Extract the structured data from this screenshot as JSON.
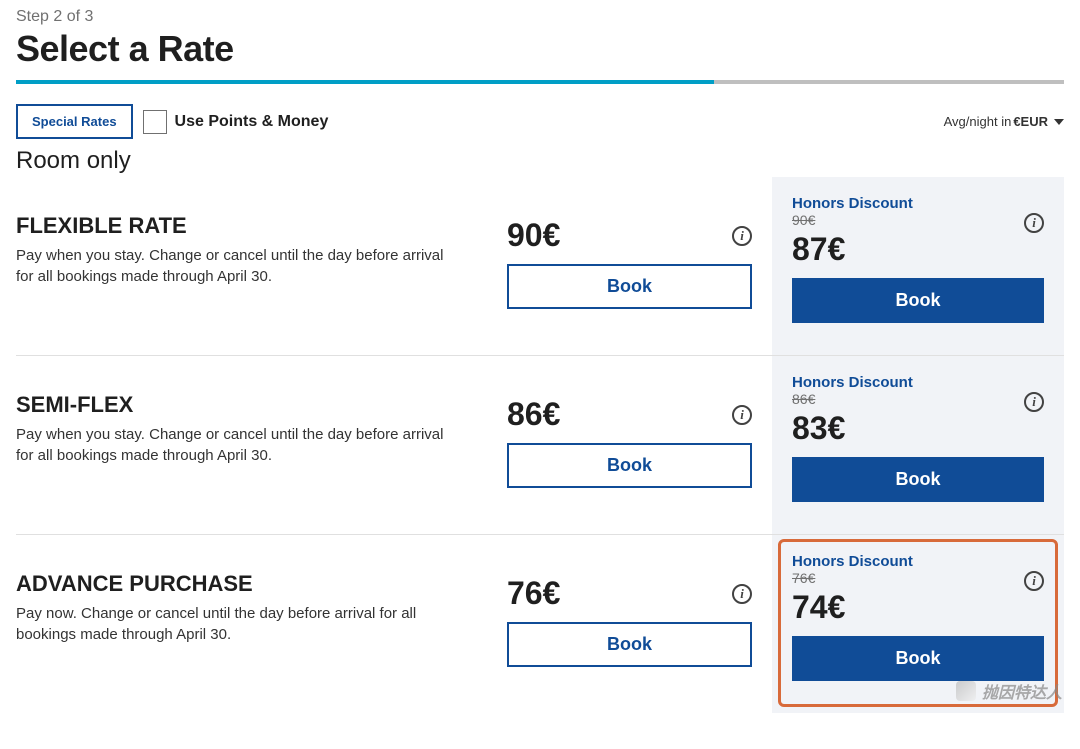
{
  "header": {
    "step": "Step 2 of 3",
    "title": "Select a Rate"
  },
  "options": {
    "special_rates": "Special Rates",
    "use_points": "Use Points & Money",
    "avg_prefix": "Avg/night in ",
    "currency": "€EUR"
  },
  "section_label": "Room only",
  "book_label": "Book",
  "honors_label": "Honors Discount",
  "info_symbol": "i",
  "rates": [
    {
      "name": "FLEXIBLE RATE",
      "desc": "Pay when you stay. Change or cancel until the day before arrival for all bookings made through April 30.",
      "price": "90€",
      "honors_strike": "90€",
      "honors_price": "87€",
      "highlight": false
    },
    {
      "name": "SEMI-FLEX",
      "desc": "Pay when you stay. Change or cancel until the day before arrival for all bookings made through April 30.",
      "price": "86€",
      "honors_strike": "86€",
      "honors_price": "83€",
      "highlight": false
    },
    {
      "name": "ADVANCE PURCHASE",
      "desc": "Pay now. Change or cancel until the day before arrival for all bookings made through April 30.",
      "price": "76€",
      "honors_strike": "76€",
      "honors_price": "74€",
      "highlight": true
    }
  ],
  "watermark": "抛因特达人"
}
